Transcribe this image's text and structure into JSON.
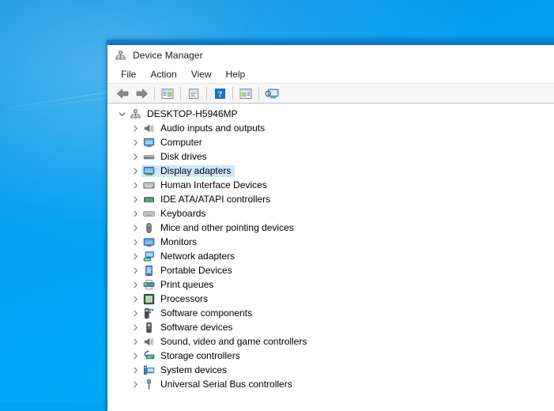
{
  "desktop": {
    "background_color": "#00a2f3",
    "name": "windows-desktop"
  },
  "window": {
    "title": "Device Manager",
    "title_icon": "device-manager-icon",
    "accent_color": "#0b7ad0"
  },
  "menubar": {
    "items": [
      {
        "label": "File",
        "name": "menu-file"
      },
      {
        "label": "Action",
        "name": "menu-action"
      },
      {
        "label": "View",
        "name": "menu-view"
      },
      {
        "label": "Help",
        "name": "menu-help"
      }
    ]
  },
  "toolbar": {
    "buttons": [
      {
        "icon": "back-arrow-icon",
        "tooltip": "Back"
      },
      {
        "icon": "forward-arrow-icon",
        "tooltip": "Forward"
      },
      {
        "icon": "show-hide-console-tree-icon",
        "tooltip": "Show/Hide Console Tree"
      },
      {
        "icon": "properties-icon",
        "tooltip": "Properties"
      },
      {
        "icon": "help-icon",
        "tooltip": "Help"
      },
      {
        "icon": "show-hide-action-pane-icon",
        "tooltip": "Show/Hide Action Pane"
      },
      {
        "icon": "scan-for-hardware-changes-icon",
        "tooltip": "Scan for hardware changes"
      }
    ]
  },
  "tree": {
    "root": {
      "label": "DESKTOP-H5946MP",
      "icon": "computer-root-icon",
      "expanded": true,
      "twisty": "chevron-down-icon"
    },
    "selected_item": "Display adapters",
    "selection_color": "#cde8ff",
    "items": [
      {
        "label": "Audio inputs and outputs",
        "icon": "speaker-icon",
        "twisty": "chevron-right-icon",
        "selected": false
      },
      {
        "label": "Computer",
        "icon": "monitor-icon",
        "twisty": "chevron-right-icon",
        "selected": false
      },
      {
        "label": "Disk drives",
        "icon": "disk-drive-icon",
        "twisty": "chevron-right-icon",
        "selected": false
      },
      {
        "label": "Display adapters",
        "icon": "display-adapter-icon",
        "twisty": "chevron-right-icon",
        "selected": true
      },
      {
        "label": "Human Interface Devices",
        "icon": "hid-icon",
        "twisty": "chevron-right-icon",
        "selected": false
      },
      {
        "label": "IDE ATA/ATAPI controllers",
        "icon": "ide-controller-icon",
        "twisty": "chevron-right-icon",
        "selected": false
      },
      {
        "label": "Keyboards",
        "icon": "keyboard-icon",
        "twisty": "chevron-right-icon",
        "selected": false
      },
      {
        "label": "Mice and other pointing devices",
        "icon": "mouse-icon",
        "twisty": "chevron-right-icon",
        "selected": false
      },
      {
        "label": "Monitors",
        "icon": "monitor-blue-icon",
        "twisty": "chevron-right-icon",
        "selected": false
      },
      {
        "label": "Network adapters",
        "icon": "network-adapter-icon",
        "twisty": "chevron-right-icon",
        "selected": false
      },
      {
        "label": "Portable Devices",
        "icon": "portable-device-icon",
        "twisty": "chevron-right-icon",
        "selected": false
      },
      {
        "label": "Print queues",
        "icon": "printer-icon",
        "twisty": "chevron-right-icon",
        "selected": false
      },
      {
        "label": "Processors",
        "icon": "processor-icon",
        "twisty": "chevron-right-icon",
        "selected": false
      },
      {
        "label": "Software components",
        "icon": "software-component-icon",
        "twisty": "chevron-right-icon",
        "selected": false
      },
      {
        "label": "Software devices",
        "icon": "software-device-icon",
        "twisty": "chevron-right-icon",
        "selected": false
      },
      {
        "label": "Sound, video and game controllers",
        "icon": "sound-controller-icon",
        "twisty": "chevron-right-icon",
        "selected": false
      },
      {
        "label": "Storage controllers",
        "icon": "storage-controller-icon",
        "twisty": "chevron-right-icon",
        "selected": false
      },
      {
        "label": "System devices",
        "icon": "system-device-icon",
        "twisty": "chevron-right-icon",
        "selected": false
      },
      {
        "label": "Universal Serial Bus controllers",
        "icon": "usb-controller-icon",
        "twisty": "chevron-right-icon",
        "selected": false
      }
    ]
  }
}
